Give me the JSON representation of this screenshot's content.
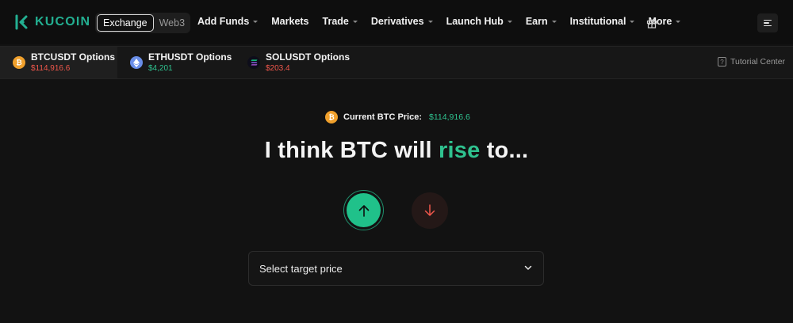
{
  "brand": {
    "name": "KUCOIN",
    "color": "#23af91"
  },
  "switch": {
    "exchange": "Exchange",
    "web3": "Web3"
  },
  "menu": [
    {
      "label": "Add Funds",
      "dropdown": true
    },
    {
      "label": "Markets",
      "dropdown": false
    },
    {
      "label": "Trade",
      "dropdown": true
    },
    {
      "label": "Derivatives",
      "dropdown": true
    },
    {
      "label": "Launch Hub",
      "dropdown": true
    },
    {
      "label": "Earn",
      "dropdown": true
    },
    {
      "label": "Institutional",
      "dropdown": true
    },
    {
      "label": "More",
      "dropdown": true
    }
  ],
  "icons": {
    "gift": "gift-icon",
    "menu": "hamburger-menu-icon"
  },
  "options": [
    {
      "name": "BTCUSDT Options",
      "price": "$114,916.6",
      "trend": "down",
      "coin": "btc",
      "coin_color": "#f0a02c",
      "active": true
    },
    {
      "name": "ETHUSDT Options",
      "price": "$4,201",
      "trend": "up",
      "coin": "eth",
      "coin_color": "#6a8ee8",
      "active": false
    },
    {
      "name": "SOLUSDT Options",
      "price": "$203.4",
      "trend": "down",
      "coin": "sol",
      "coin_color": "#0d0d1a",
      "active": false
    }
  ],
  "tutorial": {
    "label": "Tutorial Center"
  },
  "current": {
    "label": "Current BTC Price:",
    "value": "$114,916.6"
  },
  "headline": {
    "prefix": "I think BTC will ",
    "highlight": "rise",
    "suffix": " to..."
  },
  "select": {
    "placeholder": "Select target price"
  },
  "colors": {
    "up": "#2fc28f",
    "down": "#f0574b",
    "bg": "#121212"
  }
}
